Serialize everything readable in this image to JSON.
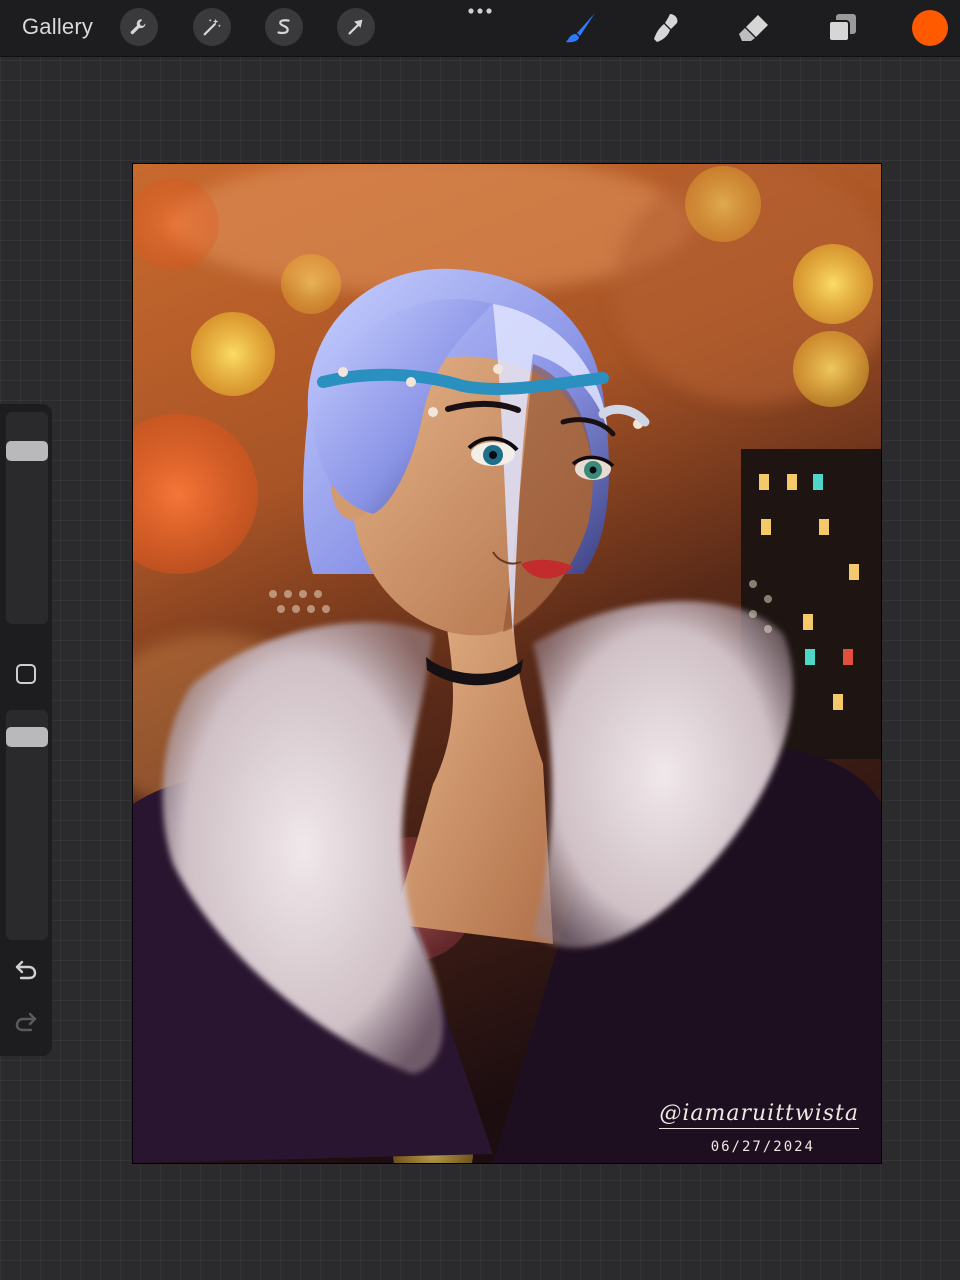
{
  "topbar": {
    "gallery_label": "Gallery",
    "actions_icons": [
      "wrench-icon",
      "magic-wand-icon",
      "selection-s-icon",
      "transform-arrow-icon"
    ],
    "more_icon": "more-dots-icon",
    "tools": [
      "brush-icon",
      "smudge-icon",
      "eraser-icon",
      "layers-icon"
    ],
    "active_tool": "brush",
    "current_color": "#ff5a00",
    "accent_color": "#2f7bff"
  },
  "sidebar": {
    "size_slider_level": 0.85,
    "opacity_slider_level": 0.92,
    "modify_icon": "square-outline-icon",
    "undo_icon": "undo-icon",
    "redo_icon": "redo-icon"
  },
  "artwork": {
    "signature": "@iamaruittwista",
    "date": "06/27/2024"
  }
}
